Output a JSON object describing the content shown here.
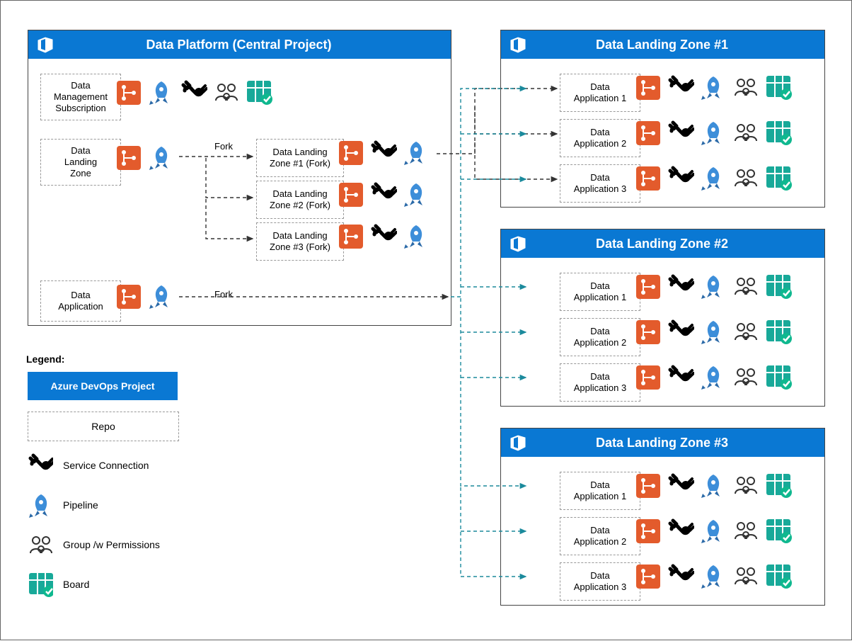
{
  "central": {
    "title": "Data Platform (Central Project)",
    "items": {
      "mgmt": "Data\nManagement\nSubscription",
      "dlz": "Data\nLanding\nZone",
      "app": "Data\nApplication",
      "fork1": "Data Landing\nZone #1 (Fork)",
      "fork2": "Data Landing\nZone #2 (Fork)",
      "fork3": "Data Landing\nZone #3 (Fork)"
    },
    "labels": {
      "fork": "Fork"
    }
  },
  "zones": [
    {
      "title": "Data Landing Zone #1",
      "apps": [
        "Data\nApplication 1",
        "Data\nApplication 2",
        "Data\nApplication 3"
      ]
    },
    {
      "title": "Data Landing Zone #2",
      "apps": [
        "Data\nApplication 1",
        "Data\nApplication 2",
        "Data\nApplication 3"
      ]
    },
    {
      "title": "Data Landing Zone #3",
      "apps": [
        "Data\nApplication 1",
        "Data\nApplication 2",
        "Data\nApplication 3"
      ]
    }
  ],
  "legend": {
    "title": "Legend:",
    "project": "Azure DevOps Project",
    "repo": "Repo",
    "sc": "Service Connection",
    "pipe": "Pipeline",
    "group": "Group /w Permissions",
    "board": "Board"
  },
  "colors": {
    "azure": "#0a78d3",
    "repo": "#e35b2c",
    "pipe": "#3d8ed9",
    "board": "#18a999"
  }
}
